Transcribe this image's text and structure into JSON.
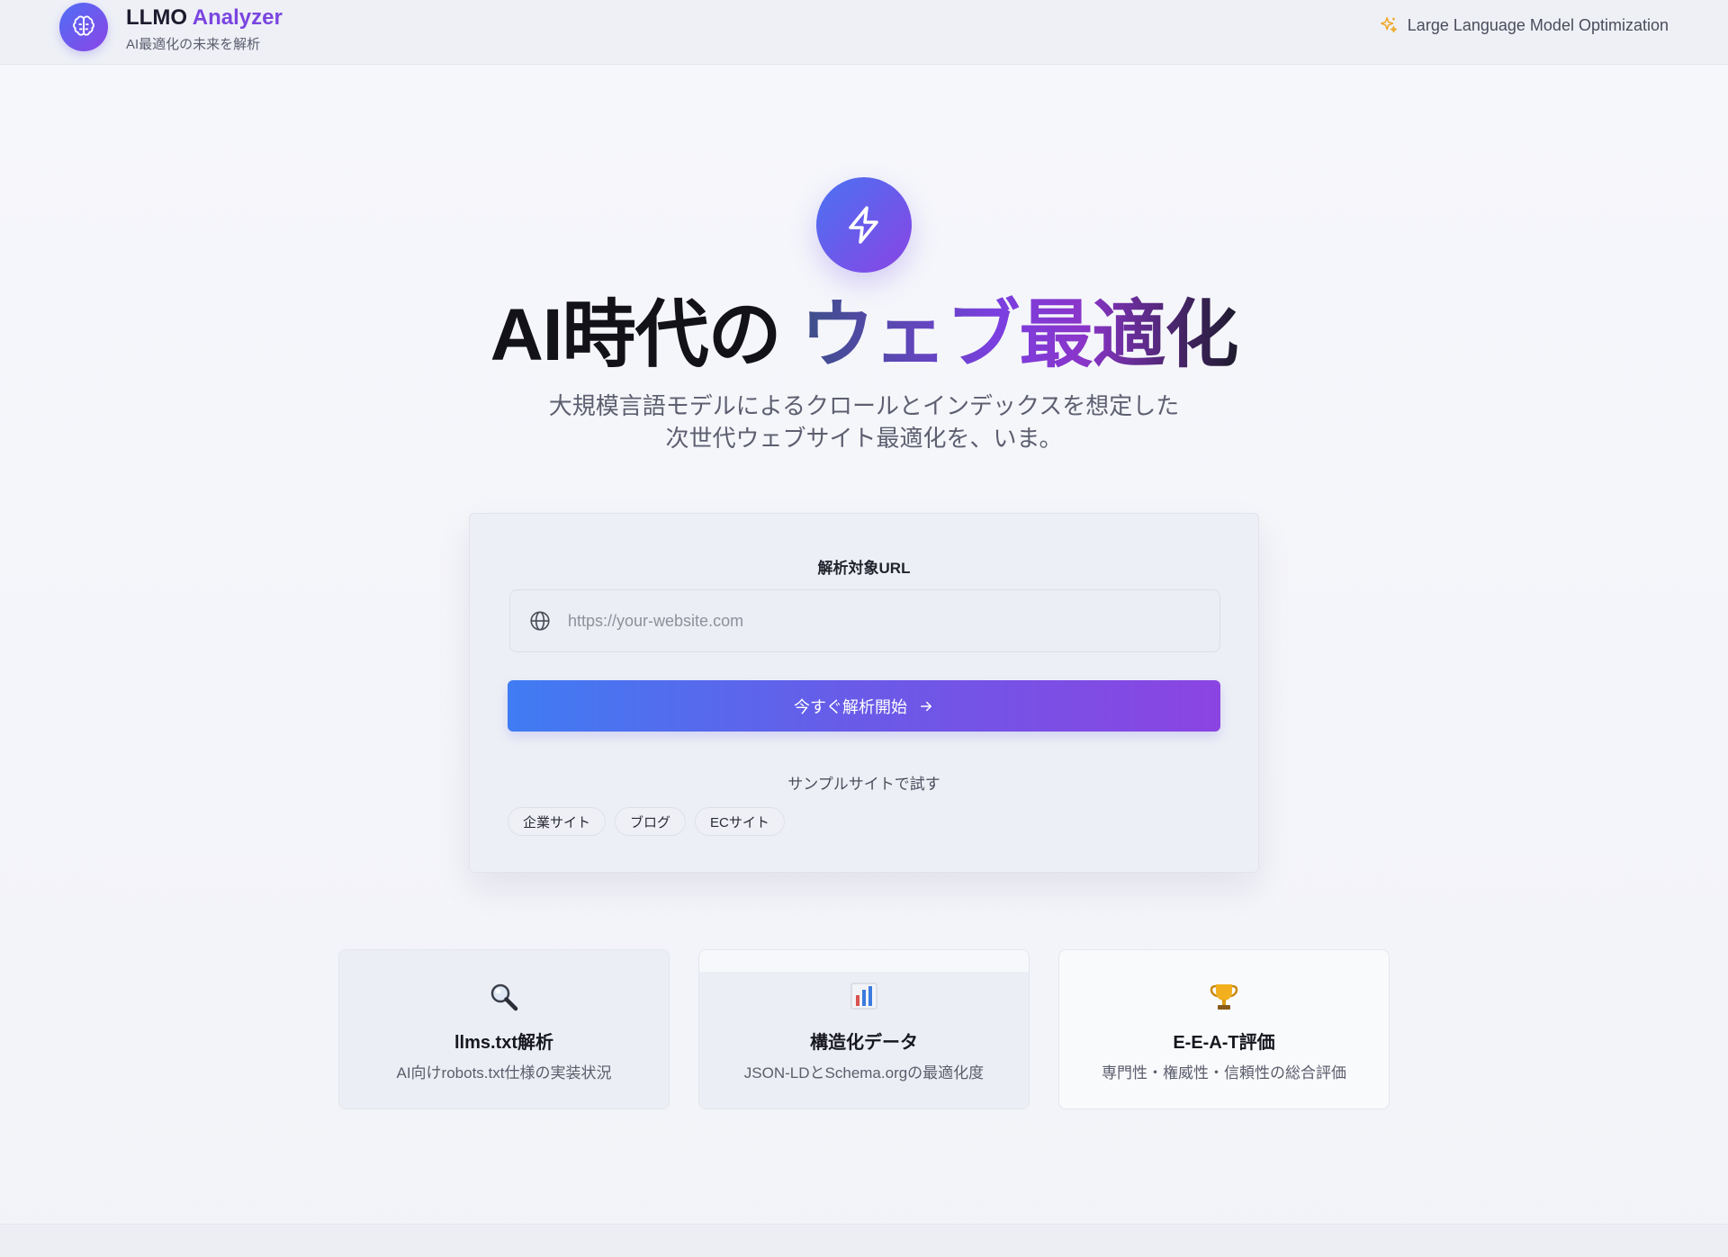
{
  "header": {
    "brand_prefix": "LLMO ",
    "brand_accent": "Analyzer",
    "brand_sub": "AI最適化の未来を解析",
    "tagline": "Large Language Model Optimization",
    "logo_icon": "brain-icon",
    "tagline_icon": "sparkles-icon"
  },
  "hero": {
    "icon": "lightning-icon",
    "title_plain": "AI時代の ",
    "title_gradient": "ウェブ最適化",
    "subtitle_line1": "大規模言語モデルによるクロールとインデックスを想定した",
    "subtitle_line2": "次世代ウェブサイト最適化を、いま。"
  },
  "form": {
    "label": "解析対象URL",
    "url_value": "",
    "url_placeholder": "https://your-website.com",
    "submit_label": "今すぐ解析開始",
    "samples_label": "サンプルサイトで試す",
    "samples": [
      "企業サイト",
      "ブログ",
      "ECサイト"
    ]
  },
  "features": [
    {
      "icon": "magnifier-icon",
      "title": "llms.txt解析",
      "desc": "AI向けrobots.txt仕様の実装状況"
    },
    {
      "icon": "bar-chart-icon",
      "title": "構造化データ",
      "desc": "JSON-LDとSchema.orgの最適化度"
    },
    {
      "icon": "trophy-icon",
      "title": "E-E-A-T評価",
      "desc": "専門性・権威性・信頼性の総合評価"
    }
  ],
  "colors": {
    "accent_blue": "#3f7cf3",
    "accent_purple": "#8b44e2"
  }
}
